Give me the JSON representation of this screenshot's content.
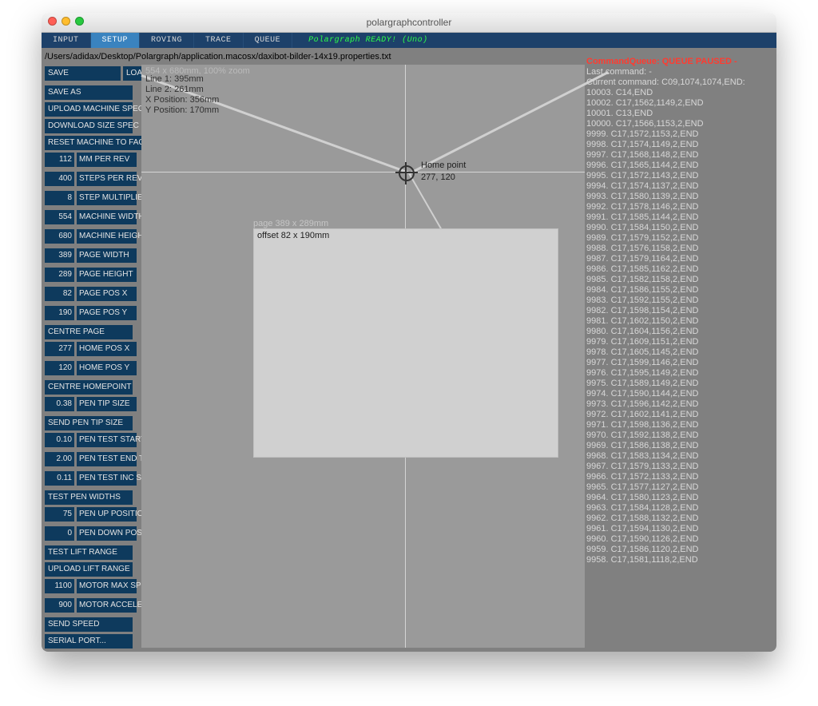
{
  "window": {
    "title": "polargraphcontroller"
  },
  "tabs": {
    "items": [
      "INPUT",
      "SETUP",
      "ROVING",
      "TRACE",
      "QUEUE"
    ],
    "active": 1,
    "ready": "Polargraph READY! (Uno)"
  },
  "filepath": "/Users/adidax/Desktop/Polargraph/application.macosx/daxibot-bilder-14x19.properties.txt",
  "zoom_text": "554 x 680mm, 100% zoom",
  "info": {
    "l0": "Line 1: 395mm",
    "l1": "Line 2: 261mm",
    "l2": "X Position: 356mm",
    "l3": "Y Position: 170mm"
  },
  "home": {
    "label": "Home point",
    "coords": "277, 120"
  },
  "page_label": "page 389 x 289mm",
  "offset_label": "offset 82 x 190mm",
  "sidebar_top": {
    "col1": [
      "SAVE",
      "SAVE AS",
      "UPLOAD MACHINE SPEC",
      "DOWNLOAD SIZE SPEC",
      "RESET MACHINE TO FACTORY"
    ],
    "col2": [
      "LOAD CONFIG"
    ]
  },
  "params": [
    {
      "v": "112",
      "l": "MM PER REV"
    },
    {
      "v": "400",
      "l": "STEPS PER REV"
    },
    {
      "v": "8",
      "l": "STEP MULTIPLIER"
    },
    {
      "v": "554",
      "l": "MACHINE WIDTH"
    },
    {
      "v": "680",
      "l": "MACHINE HEIGHT"
    },
    {
      "v": "389",
      "l": "PAGE WIDTH"
    },
    {
      "v": "289",
      "l": "PAGE HEIGHT"
    },
    {
      "v": "82",
      "l": "PAGE POS X"
    },
    {
      "v": "190",
      "l": "PAGE POS Y"
    }
  ],
  "btn_centre_page": "CENTRE PAGE",
  "params2": [
    {
      "v": "277",
      "l": "HOME POS X"
    },
    {
      "v": "120",
      "l": "HOME POS Y"
    }
  ],
  "btn_centre_home": "CENTRE HOMEPOINT",
  "params3": [
    {
      "v": "0.38",
      "l": "PEN TIP SIZE"
    }
  ],
  "btn_send_pen_tip": "SEND PEN TIP SIZE",
  "params4": [
    {
      "v": "0.10",
      "l": "PEN TEST START TIP"
    },
    {
      "v": "2.00",
      "l": "PEN TEST END TIP"
    },
    {
      "v": "0.11",
      "l": "PEN TEST INC SIZE"
    }
  ],
  "btn_test_pen_widths": "TEST PEN WIDTHS",
  "params5": [
    {
      "v": "75",
      "l": "PEN UP POSITION"
    },
    {
      "v": "0",
      "l": "PEN DOWN POSITION"
    }
  ],
  "btn_test_lift": "TEST LIFT RANGE",
  "btn_upload_lift": "UPLOAD LIFT RANGE",
  "params6": [
    {
      "v": "1100",
      "l": "MOTOR MAX SPEED"
    },
    {
      "v": "900",
      "l": "MOTOR ACCELERATION"
    }
  ],
  "btn_send_speed": "SEND SPEED",
  "btn_serial": "SERIAL PORT...",
  "queue": {
    "header": "CommandQueue: QUEUE PAUSED -",
    "last": "Last command: -",
    "current": "Current command: C09,1074,1074,END:",
    "lines": [
      "10003. C14,END",
      "10002. C17,1562,1149,2,END",
      "10001. C13,END",
      "10000. C17,1566,1153,2,END",
      "9999. C17,1572,1153,2,END",
      "9998. C17,1574,1149,2,END",
      "9997. C17,1568,1148,2,END",
      "9996. C17,1565,1144,2,END",
      "9995. C17,1572,1143,2,END",
      "9994. C17,1574,1137,2,END",
      "9993. C17,1580,1139,2,END",
      "9992. C17,1578,1146,2,END",
      "9991. C17,1585,1144,2,END",
      "9990. C17,1584,1150,2,END",
      "9989. C17,1579,1152,2,END",
      "9988. C17,1576,1158,2,END",
      "9987. C17,1579,1164,2,END",
      "9986. C17,1585,1162,2,END",
      "9985. C17,1582,1158,2,END",
      "9984. C17,1586,1155,2,END",
      "9983. C17,1592,1155,2,END",
      "9982. C17,1598,1154,2,END",
      "9981. C17,1602,1150,2,END",
      "9980. C17,1604,1156,2,END",
      "9979. C17,1609,1151,2,END",
      "9978. C17,1605,1145,2,END",
      "9977. C17,1599,1146,2,END",
      "9976. C17,1595,1149,2,END",
      "9975. C17,1589,1149,2,END",
      "9974. C17,1590,1144,2,END",
      "9973. C17,1596,1142,2,END",
      "9972. C17,1602,1141,2,END",
      "9971. C17,1598,1136,2,END",
      "9970. C17,1592,1138,2,END",
      "9969. C17,1586,1138,2,END",
      "9968. C17,1583,1134,2,END",
      "9967. C17,1579,1133,2,END",
      "9966. C17,1572,1133,2,END",
      "9965. C17,1577,1127,2,END",
      "9964. C17,1580,1123,2,END",
      "9963. C17,1584,1128,2,END",
      "9962. C17,1588,1132,2,END",
      "9961. C17,1594,1130,2,END",
      "9960. C17,1590,1126,2,END",
      "9959. C17,1586,1120,2,END",
      "9958. C17,1581,1118,2,END"
    ]
  }
}
